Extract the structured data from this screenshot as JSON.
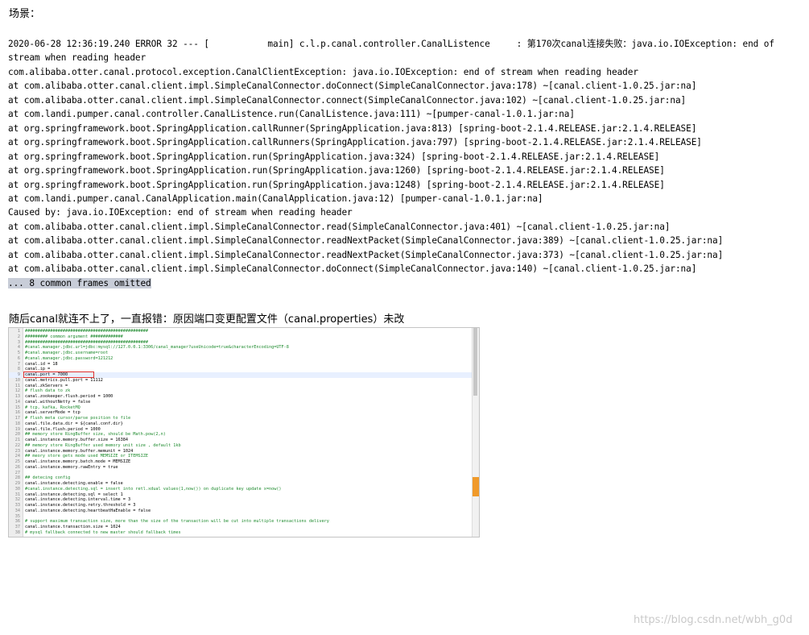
{
  "heading": "场景：",
  "log_lines": [
    "2020-06-28 12:36:19.240 ERROR 32 --- [           main] c.l.p.canal.controller.CanalListence     : 第170次canal连接失败：java.io.IOException: end of stream when reading header",
    "com.alibaba.otter.canal.protocol.exception.CanalClientException: java.io.IOException: end of stream when reading header",
    "at com.alibaba.otter.canal.client.impl.SimpleCanalConnector.doConnect(SimpleCanalConnector.java:178) ~[canal.client-1.0.25.jar:na]",
    "at com.alibaba.otter.canal.client.impl.SimpleCanalConnector.connect(SimpleCanalConnector.java:102) ~[canal.client-1.0.25.jar:na]",
    "at com.landi.pumper.canal.controller.CanalListence.run(CanalListence.java:111) ~[pumper-canal-1.0.1.jar:na]",
    "at org.springframework.boot.SpringApplication.callRunner(SpringApplication.java:813) [spring-boot-2.1.4.RELEASE.jar:2.1.4.RELEASE]",
    "at org.springframework.boot.SpringApplication.callRunners(SpringApplication.java:797) [spring-boot-2.1.4.RELEASE.jar:2.1.4.RELEASE]",
    "at org.springframework.boot.SpringApplication.run(SpringApplication.java:324) [spring-boot-2.1.4.RELEASE.jar:2.1.4.RELEASE]",
    "at org.springframework.boot.SpringApplication.run(SpringApplication.java:1260) [spring-boot-2.1.4.RELEASE.jar:2.1.4.RELEASE]",
    "at org.springframework.boot.SpringApplication.run(SpringApplication.java:1248) [spring-boot-2.1.4.RELEASE.jar:2.1.4.RELEASE]",
    "at com.landi.pumper.canal.CanalApplication.main(CanalApplication.java:12) [pumper-canal-1.0.1.jar:na]",
    "Caused by: java.io.IOException: end of stream when reading header",
    "at com.alibaba.otter.canal.client.impl.SimpleCanalConnector.read(SimpleCanalConnector.java:401) ~[canal.client-1.0.25.jar:na]",
    "at com.alibaba.otter.canal.client.impl.SimpleCanalConnector.readNextPacket(SimpleCanalConnector.java:389) ~[canal.client-1.0.25.jar:na]",
    "at com.alibaba.otter.canal.client.impl.SimpleCanalConnector.readNextPacket(SimpleCanalConnector.java:373) ~[canal.client-1.0.25.jar:na]",
    "at com.alibaba.otter.canal.client.impl.SimpleCanalConnector.doConnect(SimpleCanalConnector.java:140) ~[canal.client-1.0.25.jar:na]"
  ],
  "log_highlight": "... 8 common frames omitted",
  "note": "随后canal就连不上了，一直报错：原因端口变更配置文件（canal.properties）未改",
  "config_lines": [
    {
      "n": "1",
      "t": "#################################################",
      "c": true
    },
    {
      "n": "2",
      "t": "#########         common argument      #############",
      "c": true
    },
    {
      "n": "3",
      "t": "#################################################",
      "c": true
    },
    {
      "n": "4",
      "t": "#canal.manager.jdbc.url=jdbc:mysql://127.0.0.1:3306/canal_manager?useUnicode=true&characterEncoding=UTF-8",
      "c": true
    },
    {
      "n": "5",
      "t": "#canal.manager.jdbc.username=root",
      "c": true
    },
    {
      "n": "6",
      "t": "#canal.manager.jdbc.password=121212",
      "c": true
    },
    {
      "n": "7",
      "t": "canal.id = 18",
      "c": false
    },
    {
      "n": "8",
      "t": "canal.ip =",
      "c": false
    },
    {
      "n": "9",
      "t": "canal.port = 7000",
      "c": false,
      "active": true
    },
    {
      "n": "10",
      "t": "canal.metrics.pull.port = 11112",
      "c": false
    },
    {
      "n": "11",
      "t": "canal.zkServers =",
      "c": false
    },
    {
      "n": "12",
      "t": "# flush data to zk",
      "c": true
    },
    {
      "n": "13",
      "t": "canal.zookeeper.flush.period = 1000",
      "c": false
    },
    {
      "n": "14",
      "t": "canal.withoutNetty = false",
      "c": false
    },
    {
      "n": "15",
      "t": "# tcp, kafka, RocketMQ",
      "c": true
    },
    {
      "n": "16",
      "t": "canal.serverMode = tcp",
      "c": false
    },
    {
      "n": "17",
      "t": "# flush meta cursor/parse position to file",
      "c": true
    },
    {
      "n": "18",
      "t": "canal.file.data.dir = ${canal.conf.dir}",
      "c": false
    },
    {
      "n": "19",
      "t": "canal.file.flush.period = 1000",
      "c": false
    },
    {
      "n": "20",
      "t": "## memory store RingBuffer size, should be Math.pow(2,n)",
      "c": true
    },
    {
      "n": "21",
      "t": "canal.instance.memory.buffer.size = 16384",
      "c": false
    },
    {
      "n": "22",
      "t": "## memory store RingBuffer used memory unit size , default 1kb",
      "c": true
    },
    {
      "n": "23",
      "t": "canal.instance.memory.buffer.memunit = 1024",
      "c": false
    },
    {
      "n": "24",
      "t": "## meory store gets mode used MEMSIZE or ITEMSIZE",
      "c": true
    },
    {
      "n": "25",
      "t": "canal.instance.memory.batch.mode = MEMSIZE",
      "c": false
    },
    {
      "n": "26",
      "t": "canal.instance.memory.rawEntry = true",
      "c": false
    },
    {
      "n": "27",
      "t": "",
      "c": false
    },
    {
      "n": "28",
      "t": "## detecing config",
      "c": true
    },
    {
      "n": "29",
      "t": "canal.instance.detecting.enable = false",
      "c": false
    },
    {
      "n": "30",
      "t": "#canal.instance.detecting.sql = insert into retl.xdual values(1,now()) on duplicate key update x=now()",
      "c": true
    },
    {
      "n": "31",
      "t": "canal.instance.detecting.sql = select 1",
      "c": false
    },
    {
      "n": "32",
      "t": "canal.instance.detecting.interval.time = 3",
      "c": false
    },
    {
      "n": "33",
      "t": "canal.instance.detecting.retry.threshold = 3",
      "c": false
    },
    {
      "n": "34",
      "t": "canal.instance.detecting.heartbeatHaEnable = false",
      "c": false
    },
    {
      "n": "35",
      "t": "",
      "c": false
    },
    {
      "n": "36",
      "t": "# support maximum transaction size, more than the size of the transaction will be cut into multiple transactions delivery",
      "c": true
    },
    {
      "n": "37",
      "t": "canal.instance.transaction.size =  1024",
      "c": false
    },
    {
      "n": "38",
      "t": "# mysql fallback connected to new master should fallback times",
      "c": true
    }
  ],
  "scroll": {
    "thumb_top_fraction": 0.0,
    "thumb_height_fraction": 0.32,
    "marker_top_fraction": 0.71
  },
  "colors": {
    "highlight": "#c8cdd8",
    "comment": "#1e8b2e",
    "red_box": "#e0302c",
    "scroll_marker": "#f09a2a"
  },
  "watermark": "https://blog.csdn.net/wbh_g0d"
}
